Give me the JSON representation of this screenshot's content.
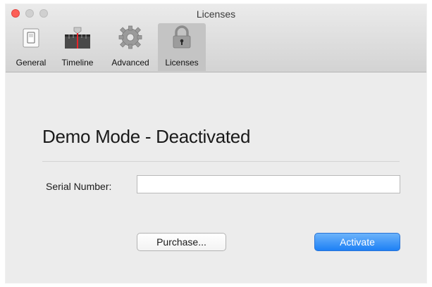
{
  "window": {
    "title": "Licenses"
  },
  "toolbar": {
    "items": [
      {
        "label": "General",
        "icon": "switch-icon",
        "selected": false
      },
      {
        "label": "Timeline",
        "icon": "timeline-icon",
        "selected": false
      },
      {
        "label": "Advanced",
        "icon": "gear-icon",
        "selected": false
      },
      {
        "label": "Licenses",
        "icon": "lock-icon",
        "selected": true
      }
    ]
  },
  "license": {
    "status_heading": "Demo Mode - Deactivated",
    "serial_label": "Serial Number:",
    "serial_value": "",
    "serial_placeholder": "",
    "purchase_label": "Purchase...",
    "activate_label": "Activate"
  },
  "colors": {
    "accent": "#1d80f5",
    "close_button": "#fc5f57",
    "timeline_marker": "#e8242a"
  }
}
